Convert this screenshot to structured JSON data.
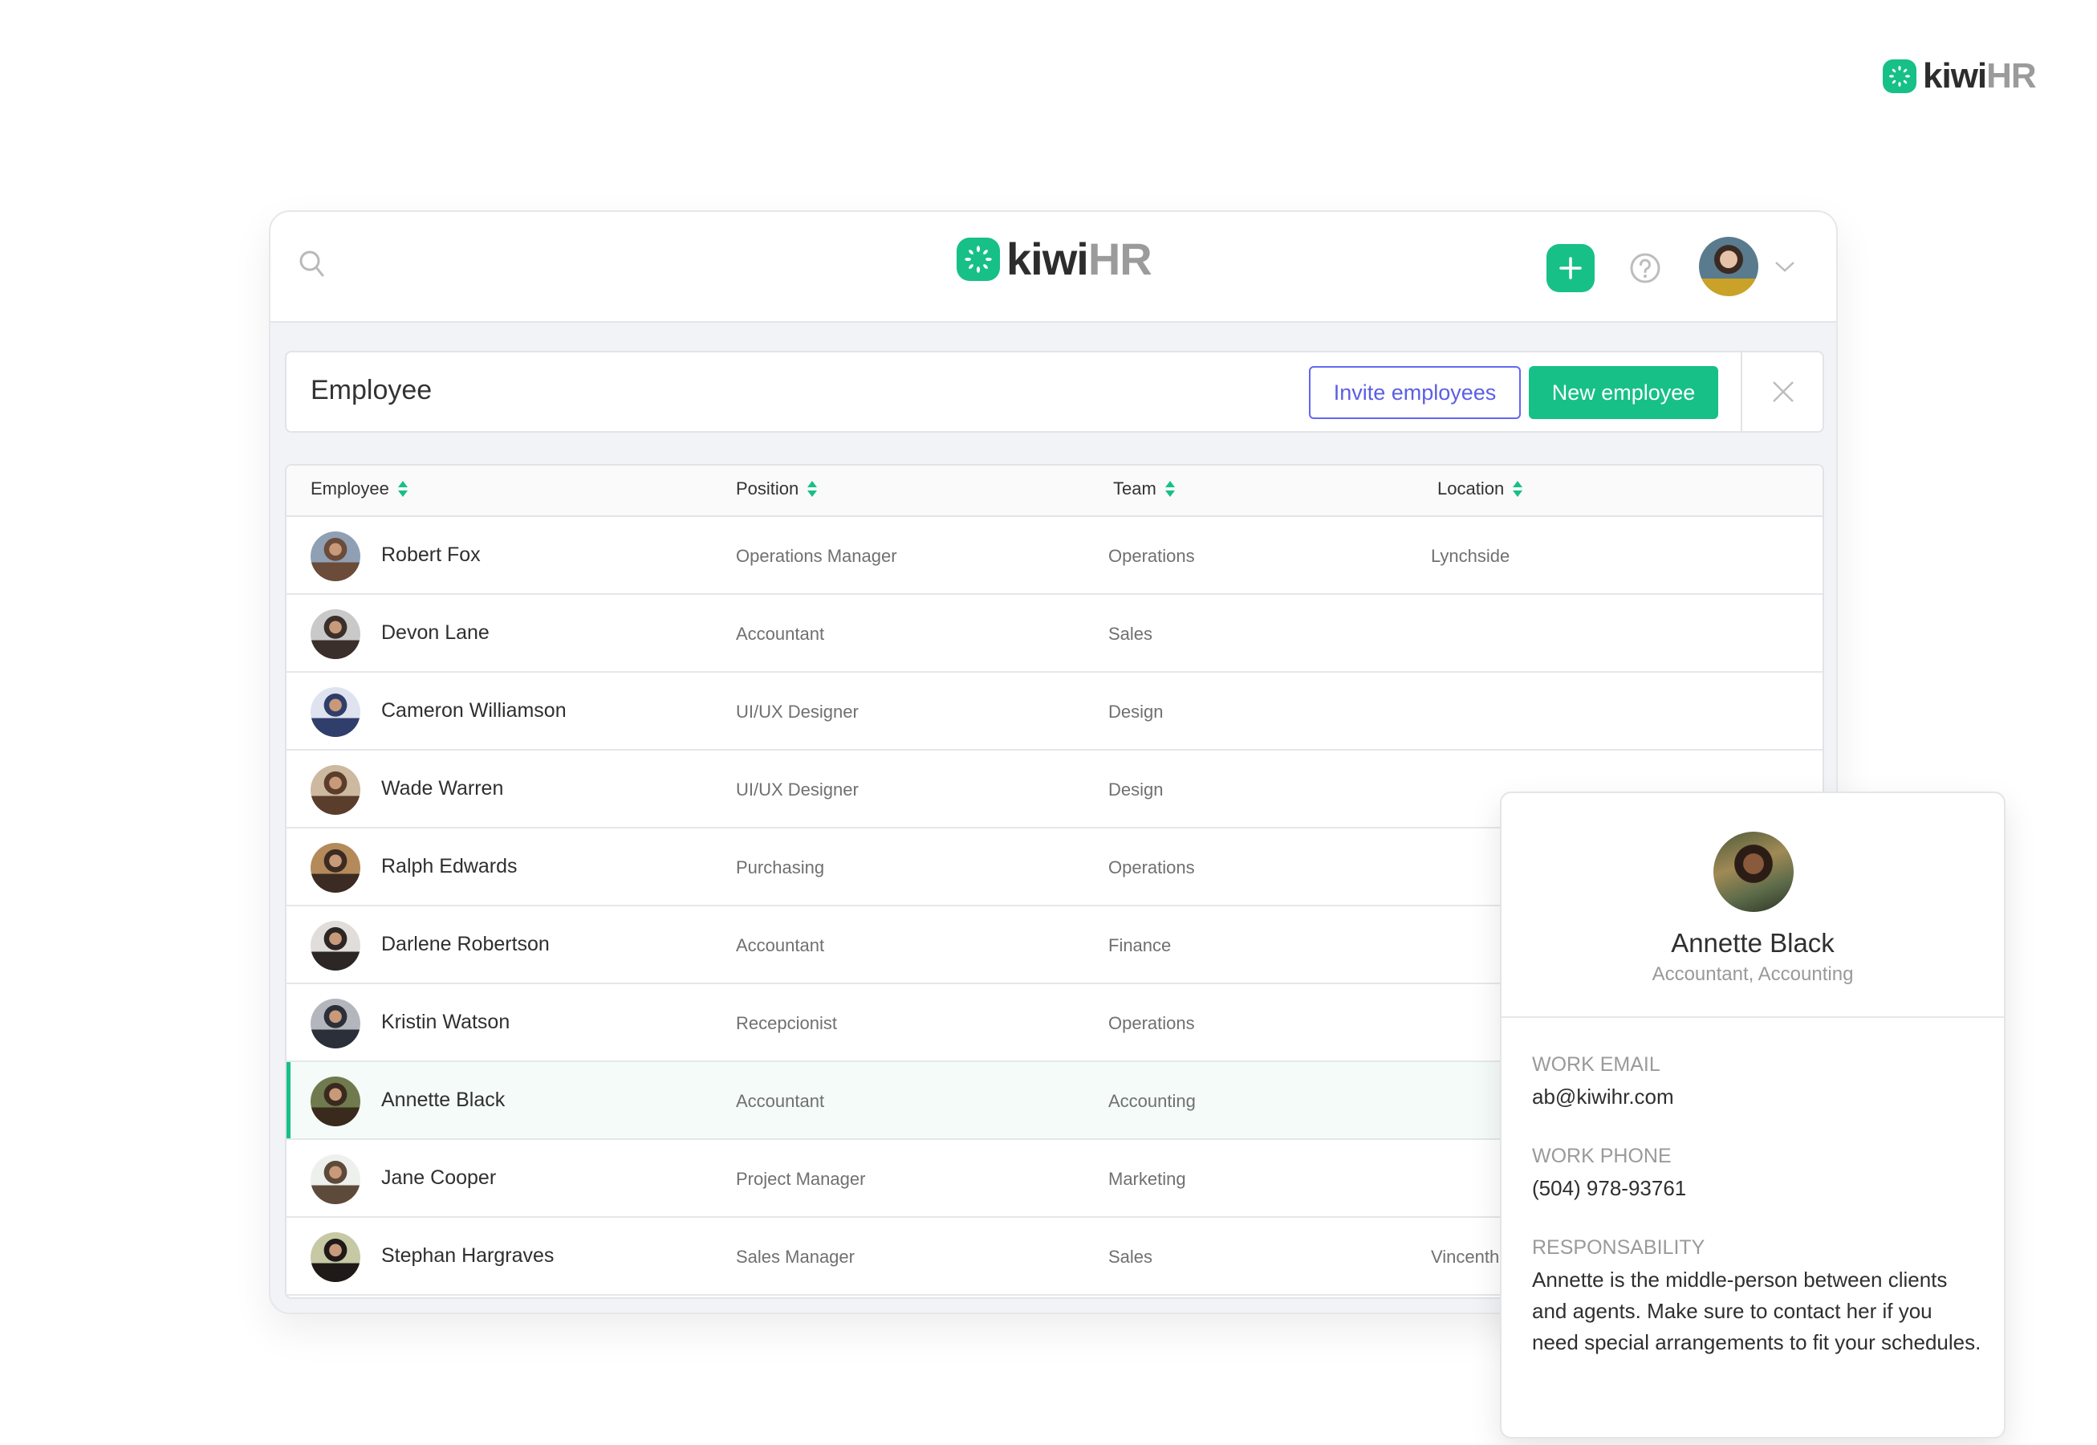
{
  "brand": {
    "name_part1": "kiwi",
    "name_part2": "HR",
    "accent_color": "#17c086"
  },
  "topbar": {
    "search_icon": "search-icon",
    "add_button_icon": "plus-icon",
    "help_icon": "help-circle-icon",
    "user_menu_icon": "chevron-down-icon"
  },
  "titlebar": {
    "title": "Employee",
    "invite_button": "Invite employees",
    "new_button": "New employee",
    "close_icon": "close-icon"
  },
  "table": {
    "columns": [
      {
        "label": "Employee"
      },
      {
        "label": "Position"
      },
      {
        "label": "Team"
      },
      {
        "label": "Location"
      }
    ],
    "rows": [
      {
        "name": "Robert Fox",
        "position": "Operations Manager",
        "team": "Operations",
        "location": "Lynchside",
        "avatar_colors": [
          "#6b4b3a",
          "#8fa0b5"
        ]
      },
      {
        "name": "Devon Lane",
        "position": "Accountant",
        "team": "Sales",
        "location": "",
        "avatar_colors": [
          "#3a2f2a",
          "#c9c9c9"
        ]
      },
      {
        "name": "Cameron Williamson",
        "position": "UI/UX Designer",
        "team": "Design",
        "location": "",
        "avatar_colors": [
          "#2f3e6b",
          "#dfe3ef"
        ]
      },
      {
        "name": "Wade Warren",
        "position": "UI/UX Designer",
        "team": "Design",
        "location": "",
        "avatar_colors": [
          "#5a3e2b",
          "#cdb8a0"
        ]
      },
      {
        "name": "Ralph Edwards",
        "position": "Purchasing",
        "team": "Operations",
        "location": "",
        "avatar_colors": [
          "#3b2b22",
          "#b48a5a"
        ]
      },
      {
        "name": "Darlene Robertson",
        "position": "Accountant",
        "team": "Finance",
        "location": "",
        "avatar_colors": [
          "#2c2624",
          "#e0ddda"
        ]
      },
      {
        "name": "Kristin Watson",
        "position": "Recepcionist",
        "team": "Operations",
        "location": "",
        "avatar_colors": [
          "#2b2f3a",
          "#b3b7bd"
        ]
      },
      {
        "name": "Annette Black",
        "position": "Accountant",
        "team": "Accounting",
        "location": "",
        "avatar_colors": [
          "#3a2a1e",
          "#6f7a4f"
        ],
        "selected": true
      },
      {
        "name": "Jane Cooper",
        "position": "Project Manager",
        "team": "Marketing",
        "location": "",
        "avatar_colors": [
          "#5d4a3a",
          "#eef0ee"
        ]
      },
      {
        "name": "Stephan Hargraves",
        "position": "Sales Manager",
        "team": "Sales",
        "location": "Vincenthaven",
        "avatar_colors": [
          "#1f1a18",
          "#c7c9a5"
        ]
      }
    ]
  },
  "popover": {
    "name": "Annette Black",
    "subtitle": "Accountant, Accounting",
    "email_label": "WORK EMAIL",
    "email": "ab@kiwihr.com",
    "phone_label": "WORK PHONE",
    "phone": "(504) 978-93761",
    "responsibility_label": "RESPONSABILITY",
    "responsibility": "Annette is the middle-person between clients and agents. Make sure to contact her if you need special arrangements to fit your schedules."
  }
}
